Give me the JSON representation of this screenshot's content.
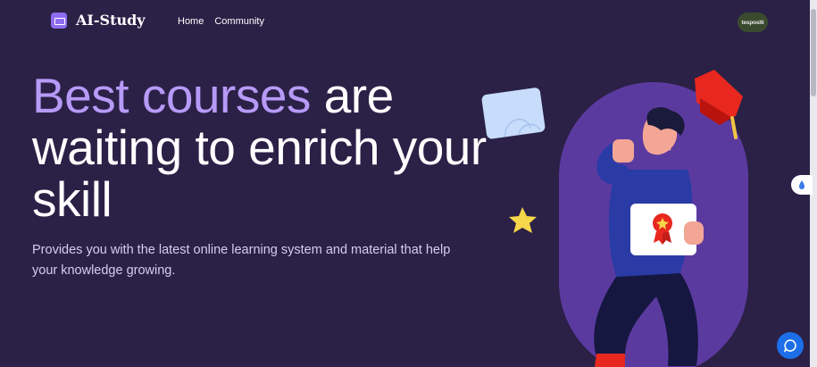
{
  "header": {
    "logo_text": "AI-Study",
    "nav": [
      {
        "label": "Home"
      },
      {
        "label": "Community"
      }
    ],
    "avatar_text": "tespositi"
  },
  "hero": {
    "title_accent": "Best courses",
    "title_rest": " are waiting to enrich your skill",
    "subtitle": "Provides you with the latest online learning system and material that help your knowledge growing."
  },
  "colors": {
    "background": "#2b2046",
    "accent": "#b79af7",
    "chat_button": "#1c6fe8"
  },
  "icons": [
    "logo-icon",
    "chat-icon",
    "side-widget-icon"
  ]
}
